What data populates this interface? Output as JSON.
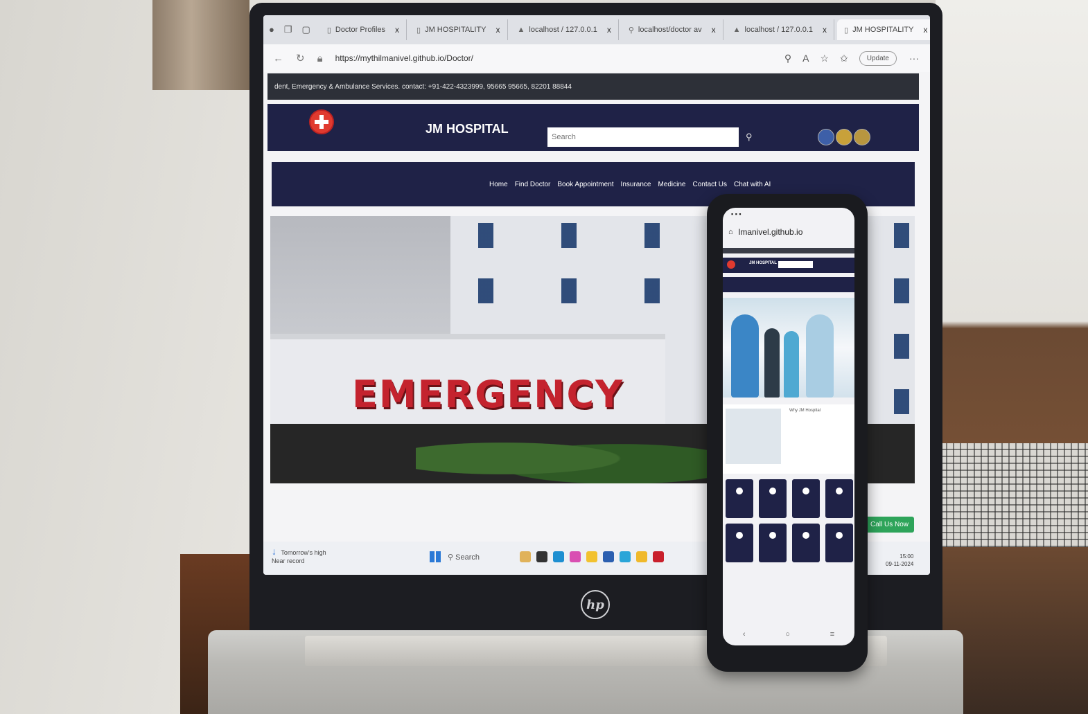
{
  "browser": {
    "tabs": [
      {
        "label": "Doctor Profiles",
        "active": false
      },
      {
        "label": "JM HOSPITALITY",
        "active": false
      },
      {
        "label": "localhost / 127.0.0.1",
        "active": false
      },
      {
        "label": "localhost/doctor av",
        "active": false
      },
      {
        "label": "localhost / 127.0.0.1",
        "active": false
      },
      {
        "label": "JM HOSPITALITY",
        "active": true
      }
    ],
    "url": "https://mythilmanivel.github.io/Doctor/",
    "update_label": "Update"
  },
  "site": {
    "top_strip": "dent, Emergency & Ambulance Services. contact: +91-422-4323999, 95665 95665, 82201 88844",
    "brand": "JM HOSPITAL",
    "search_placeholder": "Search",
    "nav": [
      "Home",
      "Find Doctor",
      "Book Appointment",
      "Insurance",
      "Medicine",
      "Contact Us",
      "Chat with AI"
    ],
    "hero_sign": "EMERGENCY",
    "call_now": "Call Us Now"
  },
  "taskbar": {
    "weather_line1": "Tomorrow's high",
    "weather_line2": "Near record",
    "search_label": "Search",
    "time": "15:00",
    "date": "09-11-2024"
  },
  "phone": {
    "url": "lmanivel.github.io",
    "brand": "JM HOSPITAL",
    "why_title": "Why JM Hospital"
  },
  "laptop": {
    "logo": "hp"
  },
  "colors": {
    "brand_navy": "#1f2247",
    "emergency_red": "#c4232e",
    "call_green": "#2ea45a"
  }
}
